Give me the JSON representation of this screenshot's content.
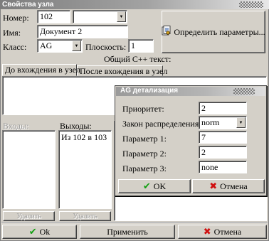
{
  "window": {
    "title": "Свойства узла"
  },
  "form": {
    "number_label": "Номер:",
    "number_value": "102",
    "number_combo_value": "",
    "name_label": "Имя:",
    "name_value": "Документ 2",
    "class_label": "Класс:",
    "class_value": "AG",
    "plane_label": "Плоскость:",
    "plane_value": "1"
  },
  "define_button": {
    "label": "Определить параметры..."
  },
  "cpp": {
    "heading": "Общий С++ текст:",
    "tabs": [
      {
        "label": "До вхождения в узел",
        "active": true
      },
      {
        "label": "После вхождения в узел",
        "active": false
      }
    ]
  },
  "inputs_list": {
    "header": "Входы:",
    "items": [],
    "delete_label": "Удалить"
  },
  "outputs_list": {
    "header": "Выходы:",
    "items": [
      "Из 102 в 103"
    ],
    "delete_label": "Удалить"
  },
  "footer": {
    "ok": "Ok",
    "apply": "Применить",
    "cancel": "Отмена"
  },
  "ag_dialog": {
    "title": "AG детализация",
    "priority_label": "Приоритет:",
    "priority_value": "2",
    "law_label": "Закон распределения:",
    "law_value": "norm",
    "param1_label": "Параметр 1:",
    "param1_value": "7",
    "param2_label": "Параметр 2:",
    "param2_value": "2",
    "param3_label": "Параметр 3:",
    "param3_value": "none",
    "ok": "OK",
    "cancel": "Отмена"
  },
  "icons": {
    "ok": "check-icon",
    "cancel": "cross-icon",
    "define": "settings-doc-icon",
    "dropdown": "triangle-down-icon"
  },
  "colors": {
    "ok_icon": "#12a012",
    "cancel_icon": "#d01010",
    "face": "#d4d0c8"
  }
}
